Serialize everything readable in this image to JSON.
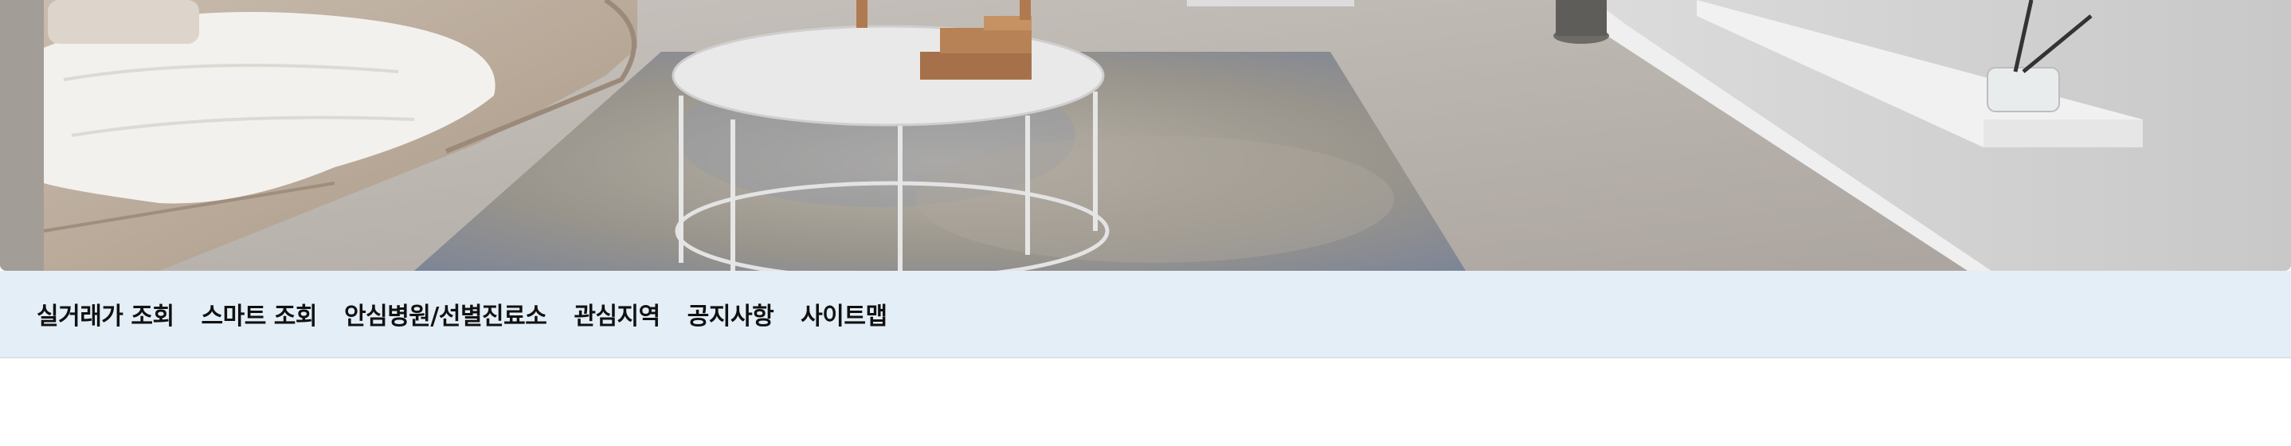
{
  "hero": {
    "image_icon": "living-room-photo"
  },
  "nav": {
    "items": [
      {
        "label": "실거래가 조회"
      },
      {
        "label": "스마트 조회"
      },
      {
        "label": "안심병원/선별진료소"
      },
      {
        "label": "관심지역"
      },
      {
        "label": "공지사항"
      },
      {
        "label": "사이트맵"
      }
    ]
  },
  "colors": {
    "menu_bg": "#e4eef6",
    "menu_text": "#111111",
    "page_bg": "#ffffff"
  }
}
